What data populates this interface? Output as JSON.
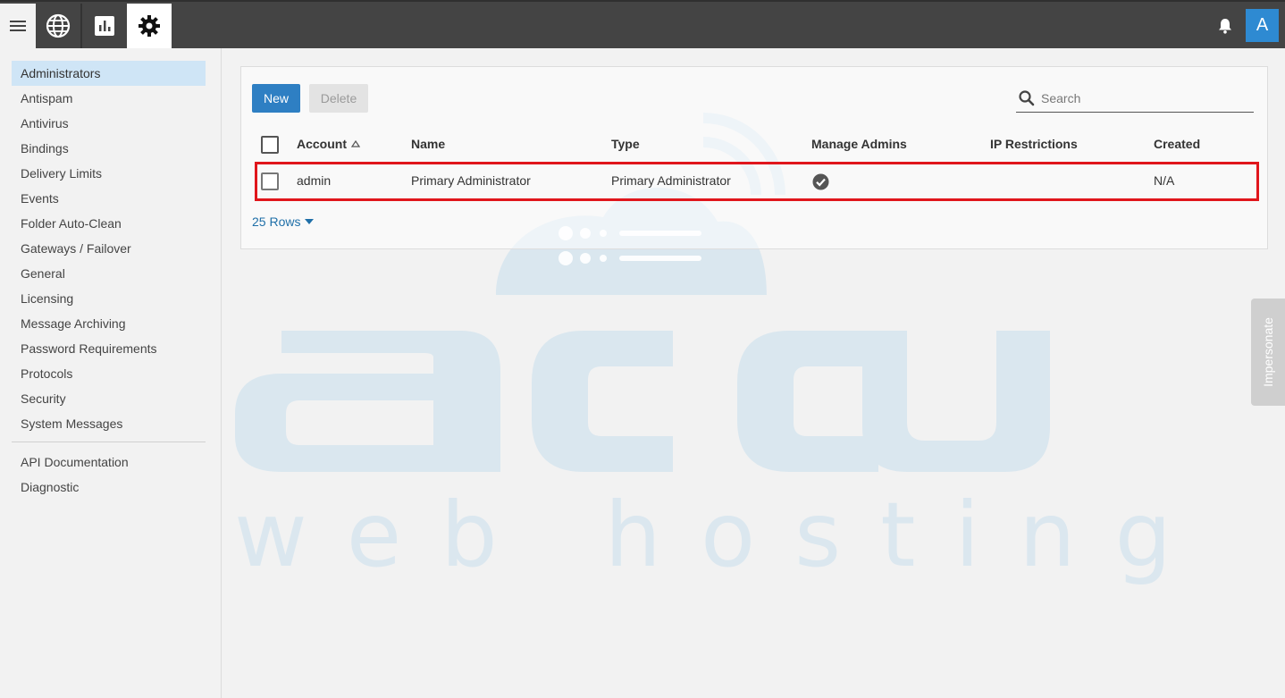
{
  "topbar": {
    "icons": [
      "menu-icon",
      "globe-icon",
      "chart-icon",
      "gear-icon",
      "bell-icon"
    ],
    "avatar_letter": "A",
    "colors": {
      "bar": "#444444",
      "avatar": "#2e8ad2"
    }
  },
  "sidebar": {
    "items": [
      {
        "label": "Administrators",
        "active": true
      },
      {
        "label": "Antispam"
      },
      {
        "label": "Antivirus"
      },
      {
        "label": "Bindings"
      },
      {
        "label": "Delivery Limits"
      },
      {
        "label": "Events"
      },
      {
        "label": "Folder Auto-Clean"
      },
      {
        "label": "Gateways / Failover"
      },
      {
        "label": "General"
      },
      {
        "label": "Licensing"
      },
      {
        "label": "Message Archiving"
      },
      {
        "label": "Password Requirements"
      },
      {
        "label": "Protocols"
      },
      {
        "label": "Security"
      },
      {
        "label": "System Messages"
      }
    ],
    "secondary_items": [
      {
        "label": "API Documentation"
      },
      {
        "label": "Diagnostic"
      }
    ]
  },
  "toolbar": {
    "new_label": "New",
    "delete_label": "Delete",
    "search_placeholder": "Search"
  },
  "table": {
    "columns": [
      "Account",
      "Name",
      "Type",
      "Manage Admins",
      "IP Restrictions",
      "Created"
    ],
    "sort_column": "Account",
    "rows": [
      {
        "account": "admin",
        "name": "Primary Administrator",
        "type": "Primary Administrator",
        "manage_admins": true,
        "ip_restrictions": "",
        "created": "N/A"
      }
    ],
    "rows_per_page": "25 Rows"
  },
  "watermark": {
    "logo_text": "accu",
    "tagline": "web hosting"
  },
  "impersonate_label": "Impersonate",
  "highlight_color": "#e0161c"
}
